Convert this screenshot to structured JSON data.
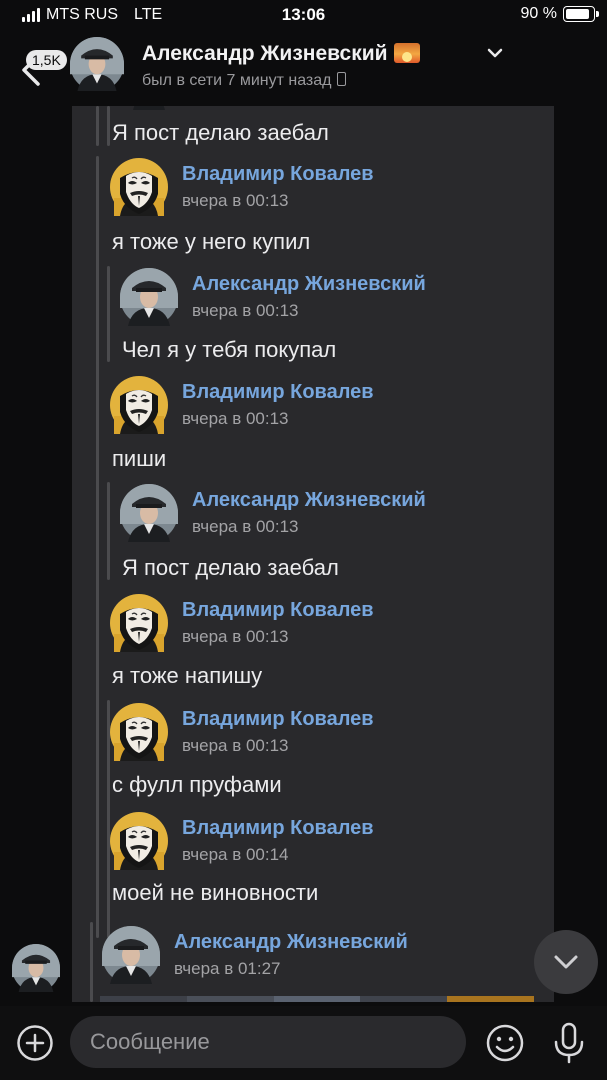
{
  "status_bar": {
    "carrier": "MTS RUS",
    "network": "LTE",
    "time": "13:06",
    "battery": "90 %"
  },
  "header": {
    "unread_count": "1,5K",
    "title": "Александр Жизневский",
    "title_emoji": "sunset-emoji",
    "status": "был в сети 7 минут назад"
  },
  "messages": [
    {
      "text": "Я пост делаю заебал"
    },
    {
      "author": "Владимир Ковалев",
      "time": "вчера в 00:13",
      "text": "я тоже у него купил"
    },
    {
      "author": "Александр Жизневский",
      "time": "вчера в 00:13",
      "text": "Чел я у тебя покупал"
    },
    {
      "author": "Владимир Ковалев",
      "time": "вчера в 00:13",
      "text": "пиши"
    },
    {
      "author": "Александр Жизневский",
      "time": "вчера в 00:13",
      "text": "Я пост делаю заебал"
    },
    {
      "author": "Владимир Ковалев",
      "time": "вчера в 00:13",
      "text": "я тоже напишу"
    },
    {
      "author": "Владимир Ковалев",
      "time": "вчера в 00:13",
      "text": "с фулл пруфами"
    },
    {
      "author": "Владимир Ковалев",
      "time": "вчера в 00:14",
      "text": "моей не виновности"
    },
    {
      "author": "Александр Жизневский",
      "time": "вчера в 01:27"
    }
  ],
  "composer": {
    "placeholder": "Сообщение"
  },
  "colors": {
    "author_name": "#77a6dd",
    "card_background": "#29292c",
    "app_background": "#0c0c0d"
  }
}
